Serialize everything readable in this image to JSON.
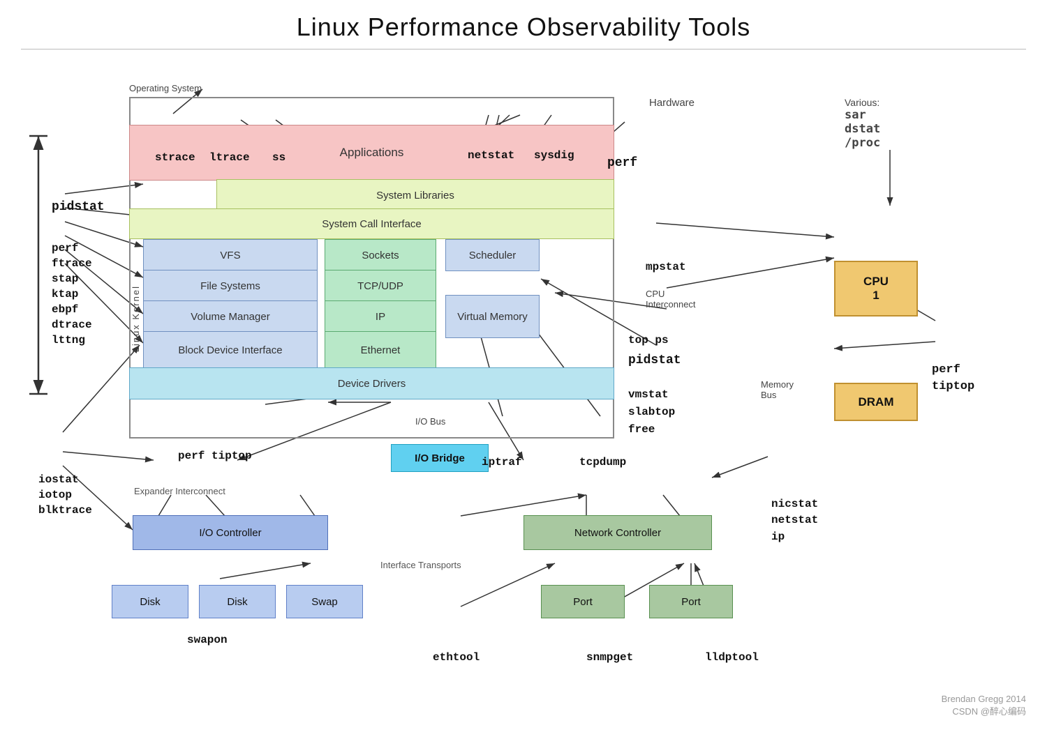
{
  "title": "Linux Performance Observability Tools",
  "credit": "Brendan Gregg 2014",
  "credit2": "CSDN @醉心编码",
  "os_label": "Operating System",
  "hw_label": "Hardware",
  "various_label": "Various:",
  "kernel_label": "Linux Kernel",
  "layers": {
    "applications": "Applications",
    "system_libraries": "System Libraries",
    "system_call_interface": "System Call Interface",
    "vfs": "VFS",
    "sockets": "Sockets",
    "scheduler": "Scheduler",
    "file_systems": "File Systems",
    "tcp_udp": "TCP/UDP",
    "volume_manager": "Volume Manager",
    "ip": "IP",
    "virtual_memory": "Virtual Memory",
    "block_device_interface": "Block Device Interface",
    "ethernet": "Ethernet",
    "device_drivers": "Device Drivers",
    "io_bridge": "I/O Bridge",
    "io_controller": "I/O Controller",
    "network_controller": "Network Controller",
    "disk1": "Disk",
    "disk2": "Disk",
    "swap": "Swap",
    "port1": "Port",
    "port2": "Port",
    "cpu": "CPU\n1",
    "dram": "DRAM"
  },
  "labels": {
    "io_bus": "I/O Bus",
    "expander_interconnect": "Expander Interconnect",
    "interface_transports": "Interface Transports",
    "cpu_interconnect": "CPU\nInterconnect",
    "memory_bus": "Memory\nBus"
  },
  "tools": {
    "strace": "strace",
    "ltrace": "ltrace",
    "ss": "ss",
    "netstat": "netstat",
    "sysdig": "sysdig",
    "pidstat_left": "pidstat",
    "perf_left": "perf",
    "ftrace": "ftrace",
    "stap": "stap",
    "ktap": "ktap",
    "ebpf": "ebpf",
    "dtrace": "dtrace",
    "lttng": "lttng",
    "iostat": "iostat",
    "iotop": "iotop",
    "blktrace": "blktrace",
    "perf_tiptop_left": "perf  tiptop",
    "swapon": "swapon",
    "iptraf": "iptraf",
    "tcpdump": "tcpdump",
    "ethtool": "ethtool",
    "snmpget": "snmpget",
    "lldptool": "lldptool",
    "nicstat": "nicstat",
    "netstat_right": "netstat",
    "ip_right": "ip",
    "perf_right": "perf",
    "mpstat": "mpstat",
    "top_ps": "top ps",
    "pidstat_right": "pidstat",
    "vmstat": "vmstat",
    "slabtop": "slabtop",
    "free": "free",
    "tiptop": "tiptop",
    "sar": "sar",
    "dstat": "dstat",
    "proc": "/proc",
    "perf_tiptop_right": "perf\ntiptop"
  }
}
